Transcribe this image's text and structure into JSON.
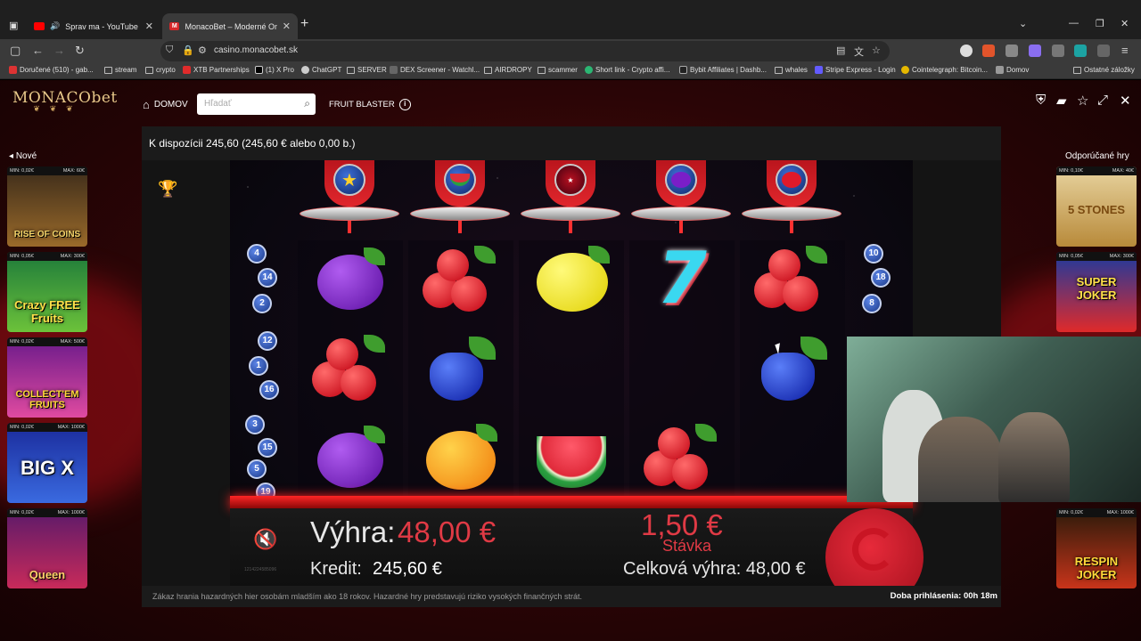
{
  "browser": {
    "tabs": [
      {
        "title": "Sprav ma - YouTube",
        "icon": "youtube-icon",
        "audio": "speaker-icon"
      },
      {
        "title": "MonacoBet – Moderné Online K",
        "icon": "monacobet-icon"
      }
    ],
    "url": "casino.monacobet.sk",
    "bookmarks": [
      "Doručené (510) - gab...",
      "stream",
      "crypto",
      "XTB Partnerships",
      "(1) X Pro",
      "ChatGPT",
      "SERVER",
      "DEX Screener - Watchl...",
      "AIRDROPY",
      "scammer",
      "Short link - Crypto affi...",
      "Bybit Affiliates | Dashb...",
      "whales",
      "Stripe Express - Login",
      "Cointelegraph: Bitcoin...",
      "Domov"
    ],
    "other_bookmarks": "Ostatné záložky"
  },
  "casino": {
    "logo": "MONACObet",
    "nav_home": "DOMOV",
    "search_placeholder": "Hľadať",
    "game_title": "FRUIT BLASTER",
    "balance_text": "K dispozícii 245,60 (245,60 € alebo 0,00 b.)",
    "left_title": "Nové",
    "right_title": "Odporúčané hry",
    "left_games": [
      {
        "name": "RISE OF COINS",
        "min": "MIN: 0,02€",
        "max": "MAX: 60€"
      },
      {
        "name": "Crazy FREE Fruits",
        "min": "MIN: 0,05€",
        "max": "MAX: 300€"
      },
      {
        "name": "COLLECT'EM FRUITS",
        "min": "MIN: 0,02€",
        "max": "MAX: 500€"
      },
      {
        "name": "BIG X",
        "min": "MIN: 0,02€",
        "max": "MAX: 1000€"
      },
      {
        "name": "Queen",
        "min": "MIN: 0,02€",
        "max": "MAX: 1000€"
      }
    ],
    "right_games": [
      {
        "name": "5 STONES",
        "min": "MIN: 0,10€",
        "max": "MAX: 40€"
      },
      {
        "name": "SUPER JOKER",
        "min": "MIN: 0,05€",
        "max": "MAX: 300€"
      },
      {
        "name": "RESPIN JOKER",
        "min": "MIN: 0,02€",
        "max": "MAX: 1000€"
      }
    ],
    "disclaimer": "Zákaz hrania hazardných hier osobám mladším ako 18 rokov. Hazardné hry predstavujú riziko vysokých finančných strát.",
    "session": "Doba prihlásenia: 00h 18m"
  },
  "game": {
    "win_label": "Výhra:",
    "win_value": "48,00 €",
    "credit_label": "Kredit:",
    "credit_value": "245,60 €",
    "bet_value": "1,50 €",
    "bet_label": "Stávka",
    "total_win": "Celková výhra: 48,00 €",
    "round_id": "1214224585096",
    "left_lines": [
      "4",
      "14",
      "2",
      "12",
      "1",
      "16",
      "3",
      "15",
      "5",
      "19"
    ],
    "right_lines": [
      "10",
      "18",
      "8"
    ],
    "top_symbols": [
      "star",
      "watermelon",
      "scatter",
      "plum",
      "cherries"
    ],
    "reels": [
      [
        "plum",
        "cherries",
        "plum"
      ],
      [
        "cherries",
        "grapes",
        "orange"
      ],
      [
        "lemon",
        "empty",
        "watermelon"
      ],
      [
        "seven",
        "empty",
        "cherries"
      ],
      [
        "cherries",
        "grapes",
        "empty"
      ]
    ]
  },
  "colors": {
    "accent": "#e03a45",
    "gold": "#e8c98a",
    "bg": "#2a0506"
  }
}
